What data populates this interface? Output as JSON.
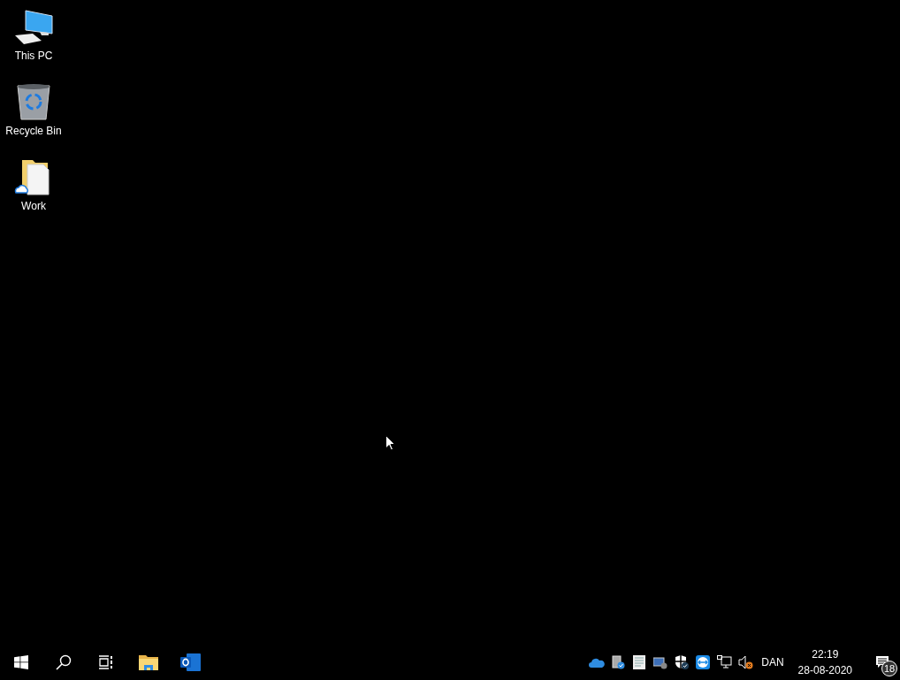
{
  "desktop_icons": [
    {
      "kind": "computer",
      "label": "This PC"
    },
    {
      "kind": "recycle-bin",
      "label": "Recycle Bin"
    },
    {
      "kind": "cloud-folder",
      "label": "Work"
    }
  ],
  "taskbar": {
    "buttons": [
      {
        "kind": "start"
      },
      {
        "kind": "search"
      },
      {
        "kind": "task-view"
      },
      {
        "kind": "file-explorer"
      },
      {
        "kind": "outlook"
      }
    ],
    "tray_icons": [
      {
        "kind": "onedrive"
      },
      {
        "kind": "sync"
      },
      {
        "kind": "document"
      },
      {
        "kind": "network-drive"
      },
      {
        "kind": "security"
      },
      {
        "kind": "teamviewer"
      },
      {
        "kind": "network"
      },
      {
        "kind": "volume-muted"
      }
    ],
    "language": "DAN",
    "time": "22:19",
    "date": "28-08-2020",
    "notification_count": "18"
  }
}
